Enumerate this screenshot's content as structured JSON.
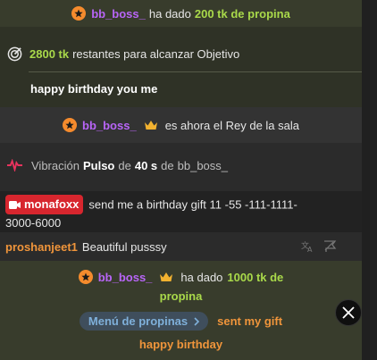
{
  "tip_top": {
    "user": "bb_boss_",
    "text": "ha dado",
    "amount": "200 tk de propina"
  },
  "goal": {
    "amount": "2800 tk",
    "text": "restantes para alcanzar Objetivo",
    "subject": "happy birthday you me"
  },
  "king": {
    "user": "bb_boss_",
    "text": "es ahora el Rey de la sala"
  },
  "vibration": {
    "label": "Vibración",
    "mode": "Pulso",
    "de1": "de",
    "duration": "40 s",
    "de2": "de",
    "user": "bb_boss_"
  },
  "monafoxx": {
    "user": "monafoxx",
    "message_line1": "send me a birthday gift 11 -55 -111-1111-",
    "message_line2": "3000-6000"
  },
  "proshan": {
    "user": "proshanjeet1",
    "message": "Beautiful pusssy"
  },
  "tip_bottom": {
    "user": "bb_boss_",
    "text": "ha dado",
    "amount_line1": "1000 tk de",
    "amount_line2": "propina",
    "menu_label": "Menú de propinas",
    "menu_action": "sent my gift",
    "item": "happy birthday"
  },
  "colors": {
    "tip_bg": "#383c2c",
    "purple": "#b865f7",
    "green": "#a9d94a",
    "orange": "#f0953b",
    "vibration_icon": "#e8335d",
    "monafoxx_badge": "#d7262e"
  },
  "icons": [
    "star-icon",
    "crown-icon",
    "goal-icon",
    "vibration-icon",
    "camera-icon",
    "translate-icon",
    "report-icon",
    "x-logo-icon",
    "chevron-right-icon"
  ]
}
